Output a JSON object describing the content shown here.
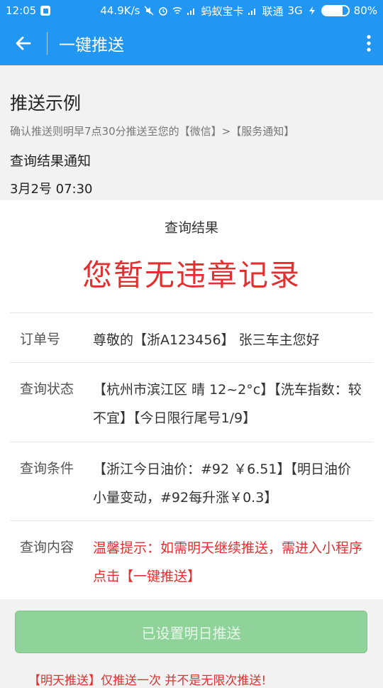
{
  "status_bar": {
    "time": "12:05",
    "speed": "44.9K/s",
    "carrier1": "蚂蚁宝卡",
    "carrier2": "联通",
    "network": "3G",
    "battery_text": "80%",
    "battery_level": 0.8
  },
  "app_bar": {
    "title": "一键推送",
    "back_icon": "back-arrow-icon",
    "more_icon": "more-vert-icon"
  },
  "example": {
    "heading": "推送示例",
    "subtitle": "确认推送则明早7点30分推送至您的【微信】>【服务通知】",
    "notice_title": "查询结果通知",
    "time": "3月2号 07:30"
  },
  "card": {
    "title": "查询结果",
    "headline": "您暂无违章记录",
    "rows": [
      {
        "label": "订单号",
        "value": "尊敬的【浙A123456】 张三车主您好"
      },
      {
        "label": "查询状态",
        "value": "【杭州市滨江区 晴 12~2°c】【洗车指数：较不宜】【今日限行尾号1/9】"
      },
      {
        "label": "查询条件",
        "value": "【浙江今日油价：#92 ￥6.51】【明日油价小量变动，#92每升涨￥0.3】"
      },
      {
        "label": "查询内容",
        "value": "温馨提示：如需明天继续推送，需进入小程序点击【一键推送】"
      }
    ]
  },
  "footer": {
    "button_label": "已设置明日推送",
    "note": "【明天推送】仅推送一次 并不是无限次推送!"
  },
  "colors": {
    "primary": "#2196f3",
    "red": "#e03030",
    "button_green": "#8fd39a"
  }
}
